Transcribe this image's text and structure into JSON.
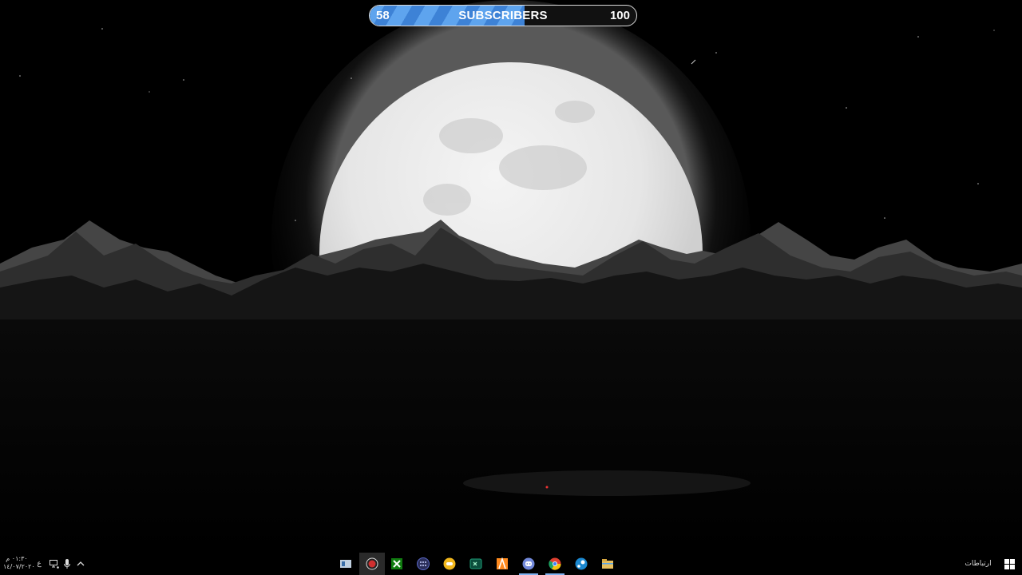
{
  "subscribers": {
    "current": "58",
    "label": "SUBSCRIBERS",
    "goal": "100",
    "progress_fraction": 0.58
  },
  "taskbar": {
    "start_icon": "windows-logo-icon",
    "language_label": "ارتباطات",
    "apps": [
      {
        "name": "file-explorer-icon",
        "color": "#e8c060"
      },
      {
        "name": "steam-icon",
        "color": "#1b88d0"
      },
      {
        "name": "chrome-icon",
        "color": "#e04030"
      },
      {
        "name": "discord-icon",
        "color": "#7289da"
      },
      {
        "name": "fl-studio-icon",
        "color": "#ff8a1e"
      },
      {
        "name": "terminal-icon",
        "color": "#1fa07a"
      },
      {
        "name": "yellow-app-icon",
        "color": "#f2b71c"
      },
      {
        "name": "app-launcher-icon",
        "color": "#5a68c8"
      },
      {
        "name": "xbox-icon",
        "color": "#107c10"
      },
      {
        "name": "obs-icon",
        "color": "#d03030"
      },
      {
        "name": "media-app-icon",
        "color": "#c0d0e0"
      }
    ],
    "tray": {
      "chevron_icon": "chevron-up-icon",
      "mic_icon": "microphone-icon",
      "network_icon": "network-icon",
      "ime_label": "ع",
      "time": "٠١:٣٠ م",
      "date": "١٤/٠٧/٢٠٢٠"
    }
  }
}
